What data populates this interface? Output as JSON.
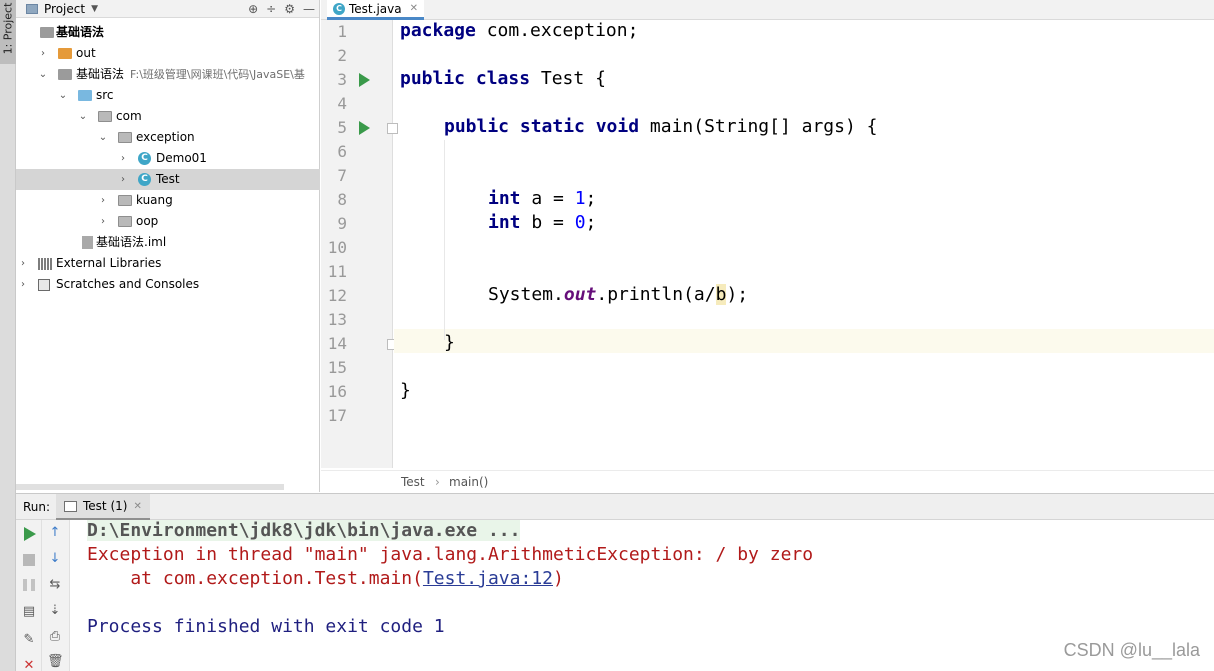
{
  "sidebar": {
    "project_tab_label": "1: Project"
  },
  "project_panel": {
    "title": "Project",
    "header_tools": [
      "⊕",
      "÷",
      "⚙",
      "—"
    ],
    "tree": [
      {
        "label": "基础语法",
        "bold": true
      },
      {
        "label": "out"
      },
      {
        "label": "基础语法",
        "path": "F:\\班级管理\\网课班\\代码\\JavaSE\\基"
      },
      {
        "label": "src"
      },
      {
        "label": "com"
      },
      {
        "label": "exception"
      },
      {
        "label": "Demo01"
      },
      {
        "label": "Test"
      },
      {
        "label": "kuang"
      },
      {
        "label": "oop"
      },
      {
        "label": "基础语法.iml"
      },
      {
        "label": "External Libraries"
      },
      {
        "label": "Scratches and Consoles"
      }
    ]
  },
  "editor": {
    "tab_label": "Test.java",
    "line_numbers": [
      "1",
      "2",
      "3",
      "4",
      "5",
      "6",
      "7",
      "8",
      "9",
      "10",
      "11",
      "12",
      "13",
      "14",
      "15",
      "16",
      "17"
    ],
    "code": {
      "l1_kw": "package",
      "l1_rest": " com.exception;",
      "l3_kw": "public class",
      "l3_rest": " Test {",
      "l5_kw": "public static void",
      "l5_rest": " main(String[] args) {",
      "l8_kw": "int",
      "l8_mid": " a = ",
      "l8_num": "1",
      "l8_end": ";",
      "l9_kw": "int",
      "l9_mid": " b = ",
      "l9_num": "0",
      "l9_end": ";",
      "l12_a": "System.",
      "l12_field": "out",
      "l12_b": ".println(a/",
      "l12_hl": "b",
      "l12_c": ");",
      "l14": "}",
      "l16": "}"
    },
    "breadcrumb": [
      "Test",
      "main()"
    ]
  },
  "run_panel": {
    "label": "Run:",
    "tab_label": "Test (1)",
    "console": {
      "cmd": "D:\\Environment\\jdk8\\jdk\\bin\\java.exe ...",
      "error": "Exception in thread \"main\" java.lang.ArithmeticException: / by zero",
      "at_prefix": "    at com.exception.Test.main(",
      "at_link": "Test.java:12",
      "at_suffix": ")",
      "finished": "Process finished with exit code 1"
    }
  },
  "watermark": "CSDN @lu__lala"
}
